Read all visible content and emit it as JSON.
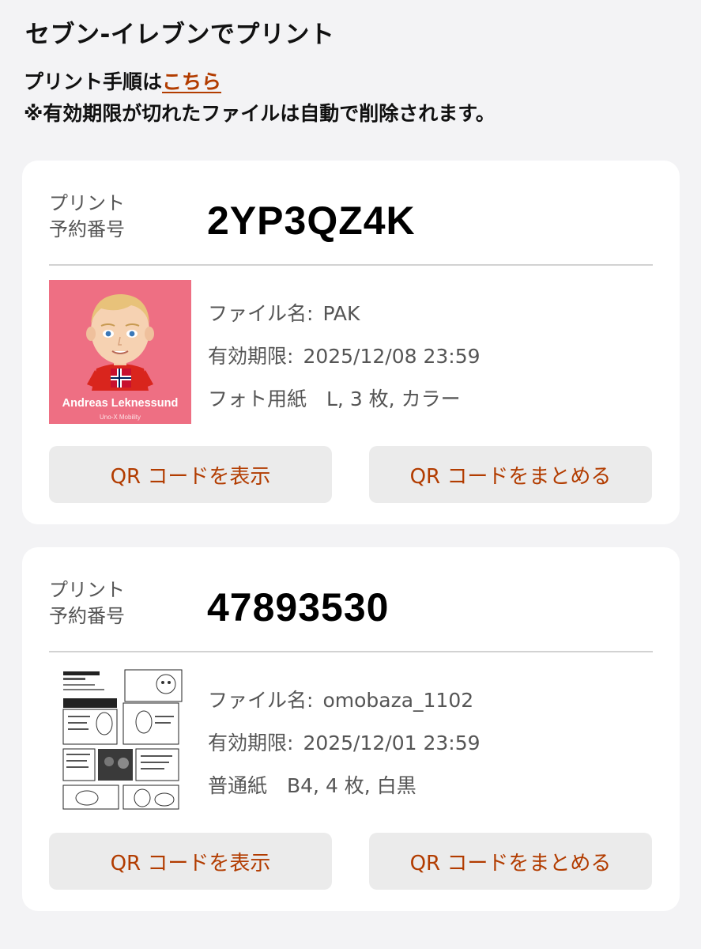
{
  "header": {
    "title": "セブン-イレブンでプリント",
    "instructions_prefix": "プリント手順は",
    "instructions_link": "こちら",
    "expiry_notice": "※有効期限が切れたファイルは自動で削除されます。"
  },
  "reservations": [
    {
      "label_line1": "プリント",
      "label_line2": "予約番号",
      "number": "2YP3QZ4K",
      "thumbnail": {
        "kind": "avatar",
        "caption_name": "Andreas Leknessund",
        "caption_team": "Uno-X Mobility",
        "background_color": "#ee6f83"
      },
      "file_name_label": "ファイル名:",
      "file_name": "PAK",
      "expiry_label": "有効期限:",
      "expiry": "2025/12/08 23:59",
      "print_spec": "フォト用紙　L, 3 枚, カラー",
      "show_qr_label": "QR コードを表示",
      "combine_qr_label": "QR コードをまとめる"
    },
    {
      "label_line1": "プリント",
      "label_line2": "予約番号",
      "number": "47893530",
      "thumbnail": {
        "kind": "manga"
      },
      "file_name_label": "ファイル名:",
      "file_name": "omobaza_1102",
      "expiry_label": "有効期限:",
      "expiry": "2025/12/01 23:59",
      "print_spec": "普通紙　B4, 4 枚, 白黒",
      "show_qr_label": "QR コードを表示",
      "combine_qr_label": "QR コードをまとめる"
    }
  ],
  "colors": {
    "accent": "#b23c00",
    "background": "#f3f3f5",
    "card": "#ffffff",
    "button": "#ebebeb"
  }
}
